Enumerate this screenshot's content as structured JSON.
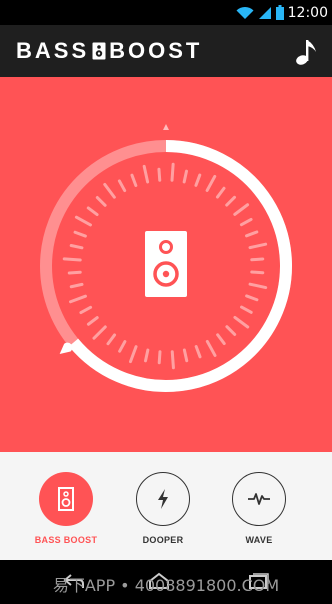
{
  "status_bar": {
    "time": "12:00"
  },
  "app_bar": {
    "title_left": "BASS",
    "title_right": "BOOST",
    "music_icon": "music-note-icon"
  },
  "boost_dial": {
    "level": 0.64
  },
  "modes": [
    {
      "label": "BASS BOOST",
      "icon": "speaker-icon",
      "active": true
    },
    {
      "label": "DOOPER",
      "icon": "lightning-icon",
      "active": false
    },
    {
      "label": "WAVE",
      "icon": "pulse-wave-icon",
      "active": false
    }
  ],
  "nav_bar": {
    "back_icon": "back-icon",
    "home_icon": "home-icon",
    "recents_icon": "recents-icon"
  },
  "watermark": "易下APP • 4008891800.COM",
  "colors": {
    "accent": "#ff5355",
    "app_bar": "#1f1f1f",
    "bottom_panel": "#f5f5f5"
  }
}
